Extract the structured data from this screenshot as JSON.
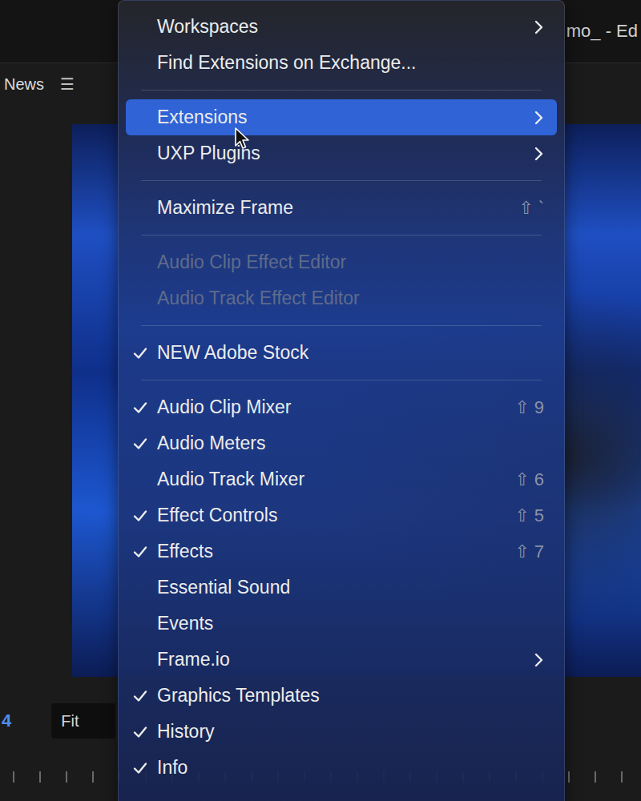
{
  "window": {
    "title": "mo_ - Ed"
  },
  "panel": {
    "label": "News",
    "menu_icon": "☰"
  },
  "viewer": {
    "timecode": "4",
    "zoom": "Fit"
  },
  "menu": {
    "sections": [
      [
        {
          "label": "Workspaces",
          "checked": false,
          "disabled": false,
          "selected": false,
          "submenu": true,
          "shortcut": ""
        },
        {
          "label": "Find Extensions on Exchange...",
          "checked": false,
          "disabled": false,
          "selected": false,
          "submenu": false,
          "shortcut": ""
        }
      ],
      [
        {
          "label": "Extensions",
          "checked": false,
          "disabled": false,
          "selected": true,
          "submenu": true,
          "shortcut": ""
        },
        {
          "label": "UXP Plugins",
          "checked": false,
          "disabled": false,
          "selected": false,
          "submenu": true,
          "shortcut": ""
        }
      ],
      [
        {
          "label": "Maximize Frame",
          "checked": false,
          "disabled": false,
          "selected": false,
          "submenu": false,
          "shortcut": "⇧ `"
        }
      ],
      [
        {
          "label": "Audio Clip Effect Editor",
          "checked": false,
          "disabled": true,
          "selected": false,
          "submenu": false,
          "shortcut": ""
        },
        {
          "label": "Audio Track Effect Editor",
          "checked": false,
          "disabled": true,
          "selected": false,
          "submenu": false,
          "shortcut": ""
        }
      ],
      [
        {
          "label": "NEW Adobe Stock",
          "checked": true,
          "disabled": false,
          "selected": false,
          "submenu": false,
          "shortcut": ""
        }
      ],
      [
        {
          "label": "Audio Clip Mixer",
          "checked": true,
          "disabled": false,
          "selected": false,
          "submenu": false,
          "shortcut": "⇧ 9"
        },
        {
          "label": "Audio Meters",
          "checked": true,
          "disabled": false,
          "selected": false,
          "submenu": false,
          "shortcut": ""
        },
        {
          "label": "Audio Track Mixer",
          "checked": false,
          "disabled": false,
          "selected": false,
          "submenu": false,
          "shortcut": "⇧ 6"
        },
        {
          "label": "Effect Controls",
          "checked": true,
          "disabled": false,
          "selected": false,
          "submenu": false,
          "shortcut": "⇧ 5"
        },
        {
          "label": "Effects",
          "checked": true,
          "disabled": false,
          "selected": false,
          "submenu": false,
          "shortcut": "⇧ 7"
        },
        {
          "label": "Essential Sound",
          "checked": false,
          "disabled": false,
          "selected": false,
          "submenu": false,
          "shortcut": ""
        },
        {
          "label": "Events",
          "checked": false,
          "disabled": false,
          "selected": false,
          "submenu": false,
          "shortcut": ""
        },
        {
          "label": "Frame.io",
          "checked": false,
          "disabled": false,
          "selected": false,
          "submenu": true,
          "shortcut": ""
        },
        {
          "label": "Graphics Templates",
          "checked": true,
          "disabled": false,
          "selected": false,
          "submenu": false,
          "shortcut": ""
        },
        {
          "label": "History",
          "checked": true,
          "disabled": false,
          "selected": false,
          "submenu": false,
          "shortcut": ""
        },
        {
          "label": "Info",
          "checked": true,
          "disabled": false,
          "selected": false,
          "submenu": false,
          "shortcut": ""
        }
      ]
    ]
  }
}
